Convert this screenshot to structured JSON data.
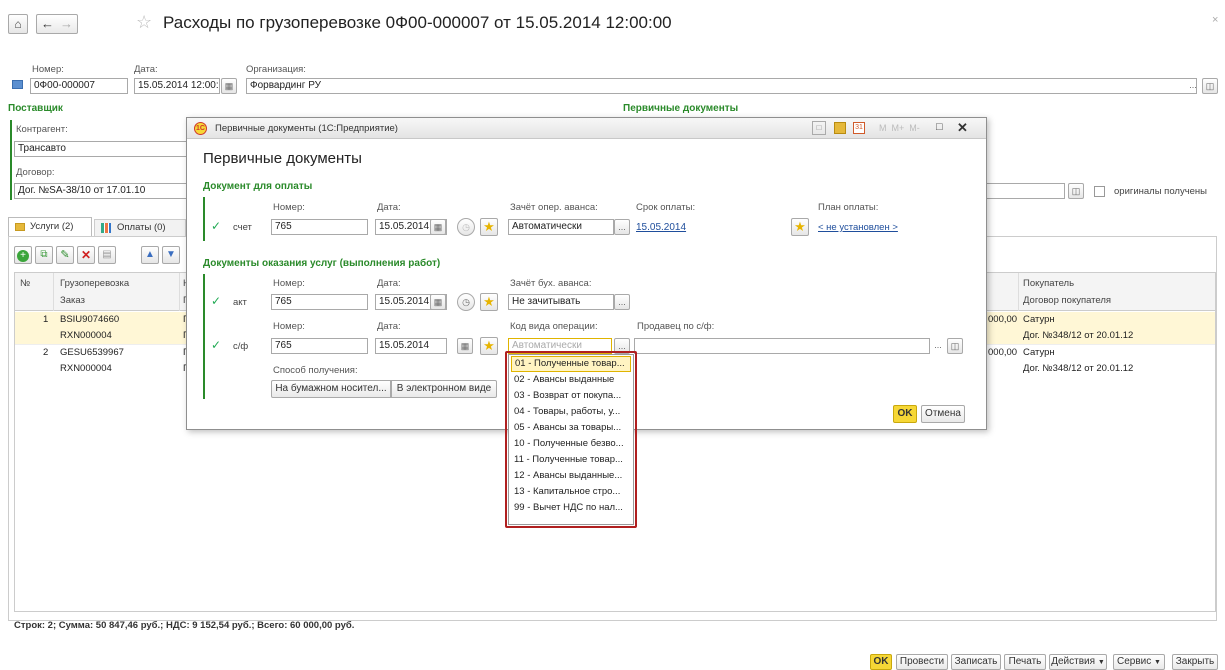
{
  "main": {
    "title": "Расходы по грузоперевозке 0Ф00-000007 от 15.05.2014 12:00:00",
    "number_label": "Номер:",
    "number": "0Ф00-000007",
    "date_label": "Дата:",
    "date": "15.05.2014 12:00:0",
    "org_label": "Организация:",
    "org": "Форвардинг РУ",
    "supplier_header": "Поставщик",
    "primary_header": "Первичные документы",
    "counterparty_label": "Контрагент:",
    "counterparty": "Трансавто",
    "contract_label": "Договор:",
    "contract": "Дог. №SA-38/10 от 17.01.10",
    "originals_label": "оригиналы получены",
    "tab_services": "Услуги (2)",
    "tab_payments": "Оплаты (0)",
    "table_headers": {
      "n": "№",
      "freight": "Грузоперевозка",
      "order": "Заказ",
      "buyer": "Покупатель",
      "buyer_contract": "Договор покупателя"
    },
    "rows": [
      {
        "n": "1",
        "freight": "BSIU9074660",
        "order": "RXN000004",
        "amount": "000,00",
        "buyer": "Сатурн",
        "buyer_contract": "Дог. №348/12 от 20.01.12",
        "col3a": "Г",
        "col3b": "Г"
      },
      {
        "n": "2",
        "freight": "GESU6539967",
        "order": "RXN000004",
        "amount": "000,00",
        "buyer": "Сатурн",
        "buyer_contract": "Дог. №348/12 от 20.01.12",
        "col3a": "Г",
        "col3b": "Г"
      }
    ],
    "footer": "Строк: 2;  Сумма: 50 847,46 руб.;  НДС: 9 152,54 руб.;  Всего: 60 000,00 руб.",
    "buttons": {
      "ok": "OK",
      "post": "Провести",
      "save": "Записать",
      "print": "Печать",
      "actions": "Действия",
      "service": "Сервис",
      "close": "Закрыть"
    }
  },
  "dialog": {
    "window_title": "Первичные документы  (1С:Предприятие)",
    "heading": "Первичные документы",
    "calc_keys": "M  M+  M-",
    "payment_section": "Документ для оплаты",
    "services_section": "Документы оказания услуг (выполнения работ)",
    "number_label": "Номер:",
    "date_label": "Дата:",
    "advance_label": "Зачёт опер. аванса:",
    "due_label": "Срок оплаты:",
    "plan_label": "План оплаты:",
    "invoice_label": "счет",
    "invoice_number": "765",
    "invoice_date": "15.05.2014",
    "advance_value": "Автоматически",
    "due_date": "15.05.2014",
    "plan_value": "< не установлен >",
    "act_label": "акт",
    "act_number": "765",
    "act_date": "15.05.2014",
    "book_advance_label": "Зачёт бух. аванса:",
    "book_advance_value": "Не зачитывать",
    "sf_label": "с/ф",
    "sf_number": "765",
    "sf_date": "15.05.2014",
    "op_code_label": "Код вида операции:",
    "op_code_placeholder": "Автоматически",
    "seller_label": "Продавец по с/ф:",
    "receipt_label": "Способ получения:",
    "paper_btn": "На бумажном носител...",
    "electronic_btn": "В электронном виде",
    "ok": "OK",
    "cancel": "Отмена"
  },
  "dropdown": [
    "01 - Полученные товар...",
    "02 - Авансы выданные",
    "03 - Возврат от покупа...",
    "04 - Товары, работы, у...",
    "05 - Авансы за товары...",
    "10 - Полученные безво...",
    "11 - Полученные товар...",
    "12 - Авансы выданные...",
    "13 - Капитальное стро...",
    "99 - Вычет НДС по нал..."
  ],
  "colors": {
    "accent_green": "#2a8a2a",
    "selected_row": "#fff7d6",
    "ok_yellow": "#f6d736",
    "highlight_border": "#b02020"
  }
}
